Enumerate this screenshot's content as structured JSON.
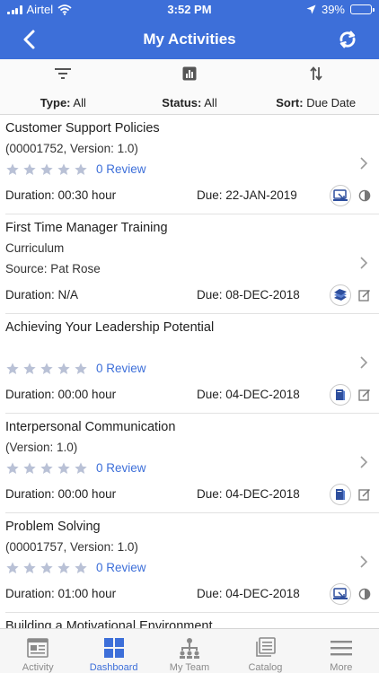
{
  "status_bar": {
    "carrier": "Airtel",
    "time": "3:52 PM",
    "battery_text": "39%",
    "battery_level": 0.39
  },
  "nav": {
    "title": "My Activities",
    "back_icon": "chevron-left-icon",
    "refresh_icon": "refresh-icon"
  },
  "filters": {
    "type_label": "Type:",
    "type_value": "All",
    "status_label": "Status:",
    "status_value": "All",
    "sort_label": "Sort:",
    "sort_value": "Due Date"
  },
  "activities": [
    {
      "title": "Customer Support Policies",
      "subtitle": "(00001752, Version: 1.0)",
      "review": "0 Review",
      "duration": "Duration: 00:30 hour",
      "due": "Due: 22-JAN-2019",
      "type_icon": "online-course-icon",
      "status_icon": "half-circle-icon"
    },
    {
      "title": "First Time Manager Training",
      "subtitle": "Curriculum",
      "source": "Source: Pat Rose",
      "duration": "Duration: N/A",
      "due": "Due: 08-DEC-2018",
      "type_icon": "curriculum-icon",
      "status_icon": "edit-icon"
    },
    {
      "title": "Achieving  Your Leadership Potential",
      "subtitle": "",
      "review": "0 Review",
      "duration": "Duration: 00:00 hour",
      "due": "Due: 04-DEC-2018",
      "type_icon": "book-icon",
      "status_icon": "edit-icon"
    },
    {
      "title": "Interpersonal Communication",
      "subtitle": "(Version: 1.0)",
      "review": "0 Review",
      "duration": "Duration: 00:00 hour",
      "due": "Due: 04-DEC-2018",
      "type_icon": "book-icon",
      "status_icon": "edit-icon"
    },
    {
      "title": "Problem Solving",
      "subtitle": "(00001757, Version: 1.0)",
      "review": "0 Review",
      "duration": "Duration: 01:00 hour",
      "due": "Due: 04-DEC-2018",
      "type_icon": "online-course-icon",
      "status_icon": "half-circle-icon"
    },
    {
      "title": "Building a Motivational Environment"
    }
  ],
  "tabs": [
    {
      "label": "Activity",
      "icon": "activity-icon",
      "active": false
    },
    {
      "label": "Dashboard",
      "icon": "dashboard-icon",
      "active": true
    },
    {
      "label": "My Team",
      "icon": "team-icon",
      "active": false
    },
    {
      "label": "Catalog",
      "icon": "catalog-icon",
      "active": false
    },
    {
      "label": "More",
      "icon": "menu-icon",
      "active": false
    }
  ],
  "colors": {
    "primary": "#3d6fd9",
    "star": "#b9c1d6",
    "tab_inactive": "#8a8a8a"
  }
}
